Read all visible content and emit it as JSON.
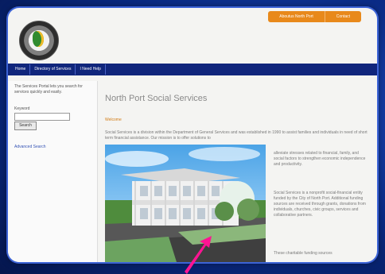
{
  "top_links": [
    "Aboutus North Port",
    "Contact"
  ],
  "nav": [
    "Home",
    "Directory of Services",
    "I Need Help"
  ],
  "left": {
    "description": "The Services Portal lets you search for services quickly and easily.",
    "search_label": "Keyword",
    "search_button": "Search",
    "advanced_link": "Advanced Search"
  },
  "main": {
    "title": "North Port Social Services",
    "welcome": "Welcome",
    "intro": "Social Services is a division within the Department of General Services and was established in 1990 to assist families and individuals in need of short term financial assistance. Our mission is to offer solutions to",
    "right_1": "alleviate stresses related to financial, family, and social factors to strengthen economic independence and productivity.",
    "right_2": "Social Services is a nonprofit social-financial entity funded by the City of North Port. Additional funding sources are received through grants, donations from individuals, churches, civic groups, services and collaborative partners.",
    "right_3": "These charitable funding sources"
  },
  "icons": {
    "logo": "city-seal-logo",
    "arrow": "pink-arrow-icon"
  },
  "colors": {
    "nav": "#10267c",
    "accent": "#e8891b",
    "arrow": "#ff1493"
  }
}
